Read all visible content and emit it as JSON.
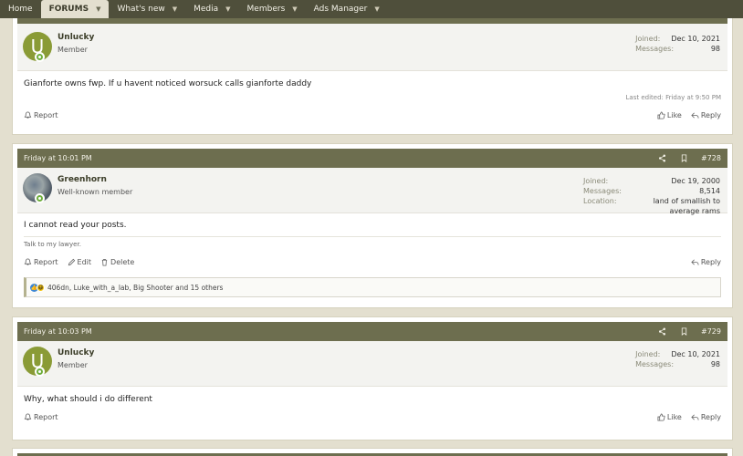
{
  "nav": {
    "items": [
      {
        "label": "Home",
        "caret": false,
        "active": false
      },
      {
        "label": "FORUMS",
        "caret": true,
        "active": true
      },
      {
        "label": "What's new",
        "caret": true,
        "active": false
      },
      {
        "label": "Media",
        "caret": true,
        "active": false
      },
      {
        "label": "Members",
        "caret": true,
        "active": false
      },
      {
        "label": "Ads Manager",
        "caret": true,
        "active": false
      }
    ]
  },
  "posts": [
    {
      "user": {
        "initial": "U",
        "name": "Unlucky",
        "title": "Member"
      },
      "stats": {
        "joined_k": "Joined:",
        "joined_v": "Dec 10, 2021",
        "messages_k": "Messages:",
        "messages_v": "98"
      },
      "text": "Gianforte owns fwp. If u havent noticed worsuck calls gianforte daddy",
      "edited": "Last edited: Friday at 9:50 PM",
      "actions": {
        "report": "Report",
        "like": "Like",
        "reply": "Reply"
      }
    },
    {
      "date": "Friday at 10:01 PM",
      "number": "#728",
      "user": {
        "name": "Greenhorn",
        "title": "Well-known member"
      },
      "stats": {
        "joined_k": "Joined:",
        "joined_v": "Dec 19, 2000",
        "messages_k": "Messages:",
        "messages_v": "8,514",
        "location_k": "Location:",
        "location_v": "land of smallish to average rams"
      },
      "text": "I cannot read your posts.",
      "signature": "Talk to my lawyer.",
      "actions": {
        "report": "Report",
        "edit": "Edit",
        "delete": "Delete",
        "reply": "Reply"
      },
      "reactions": "406dn, Luke_with_a_lab, Big Shooter and 15 others"
    },
    {
      "date": "Friday at 10:03 PM",
      "number": "#729",
      "user": {
        "initial": "U",
        "name": "Unlucky",
        "title": "Member"
      },
      "stats": {
        "joined_k": "Joined:",
        "joined_v": "Dec 10, 2021",
        "messages_k": "Messages:",
        "messages_v": "98"
      },
      "text": "Why, what should i do different",
      "actions": {
        "report": "Report",
        "like": "Like",
        "reply": "Reply"
      }
    }
  ],
  "colors": {
    "nav_bg": "#4f4f3b",
    "post_header": "#6d6e4f",
    "page_bg": "#e3dfcf",
    "online": "#6fae3c",
    "avatar_u": "#8a9b36"
  }
}
